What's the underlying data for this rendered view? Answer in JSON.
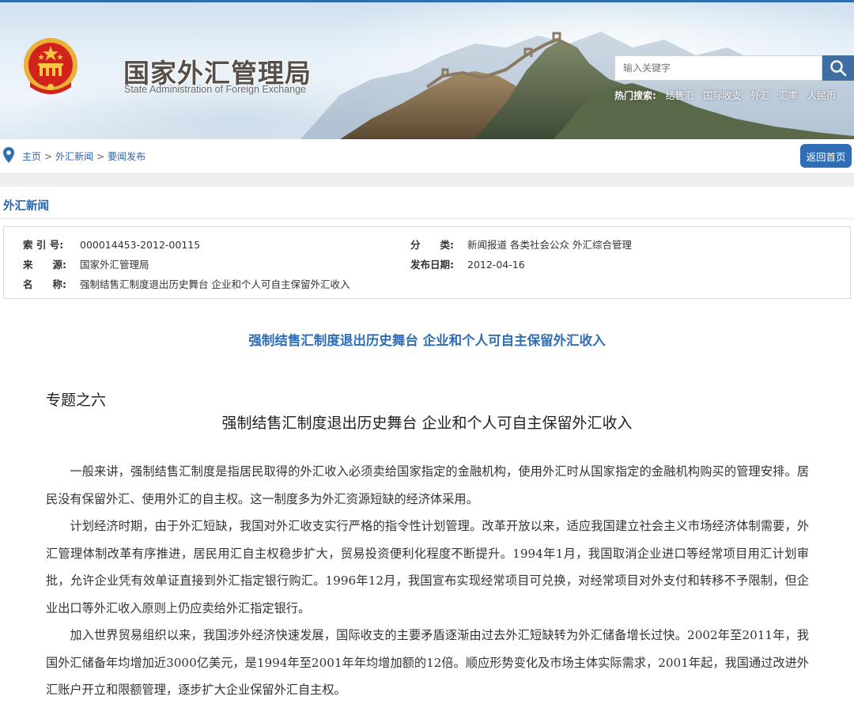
{
  "header": {
    "site_title": "国家外汇管理局",
    "site_subtitle": "State Administration of Foreign Exchange",
    "search": {
      "placeholder": "输入关键字"
    },
    "hot_search": {
      "label": "热门搜索:",
      "items": [
        "结售汇",
        "国际收支",
        "外汇",
        "汇率",
        "人民币"
      ]
    },
    "icons": {
      "emblem": "national-emblem-icon",
      "search": "search-icon"
    },
    "colors": {
      "search_button": "#3f6fa2",
      "top_stripe": "#2f6fb0"
    }
  },
  "breadcrumb": {
    "items": [
      "主页",
      "外汇新闻",
      "要闻发布"
    ],
    "separator": ">",
    "home_button": "返回首页",
    "icon": "location-pin-icon"
  },
  "section": {
    "title": "外汇新闻"
  },
  "meta": {
    "index_no_label": "索 引 号:",
    "index_no": "000014453-2012-00115",
    "category_label": "分　　类:",
    "category": "新闻报道 各类社会公众 外汇综合管理",
    "source_label": "来　　源:",
    "source": "国家外汇管理局",
    "date_label": "发布日期:",
    "date": "2012-04-16",
    "name_label": "名　　称:",
    "name": "强制结售汇制度退出历史舞台 企业和个人可自主保留外汇收入"
  },
  "article": {
    "title": "强制结售汇制度退出历史舞台 企业和个人可自主保留外汇收入",
    "topic": "专题之六",
    "subtitle": "强制结售汇制度退出历史舞台  企业和个人可自主保留外汇收入",
    "paragraphs": [
      "一般来讲，强制结售汇制度是指居民取得的外汇收入必须卖给国家指定的金融机构，使用外汇时从国家指定的金融机构购买的管理安排。居民没有保留外汇、使用外汇的自主权。这一制度多为外汇资源短缺的经济体采用。",
      "计划经济时期，由于外汇短缺，我国对外汇收支实行严格的指令性计划管理。改革开放以来，适应我国建立社会主义市场经济体制需要，外汇管理体制改革有序推进，居民用汇自主权稳步扩大，贸易投资便利化程度不断提升。1994年1月，我国取消企业进口等经常项目用汇计划审批，允许企业凭有效单证直接到外汇指定银行购汇。1996年12月，我国宣布实现经常项目可兑换，对经常项目对外支付和转移不予限制，但企业出口等外汇收入原则上仍应卖给外汇指定银行。",
      "加入世界贸易组织以来，我国涉外经济快速发展，国际收支的主要矛盾逐渐由过去外汇短缺转为外汇储备增长过快。2002年至2011年，我国外汇储备年均增加近3000亿美元，是1994年至2001年年均增加额的12倍。顺应形势变化及市场主体实际需求，2001年起，我国通过改进外汇账户开立和限额管理，逐步扩大企业保留外汇自主权。"
    ]
  }
}
